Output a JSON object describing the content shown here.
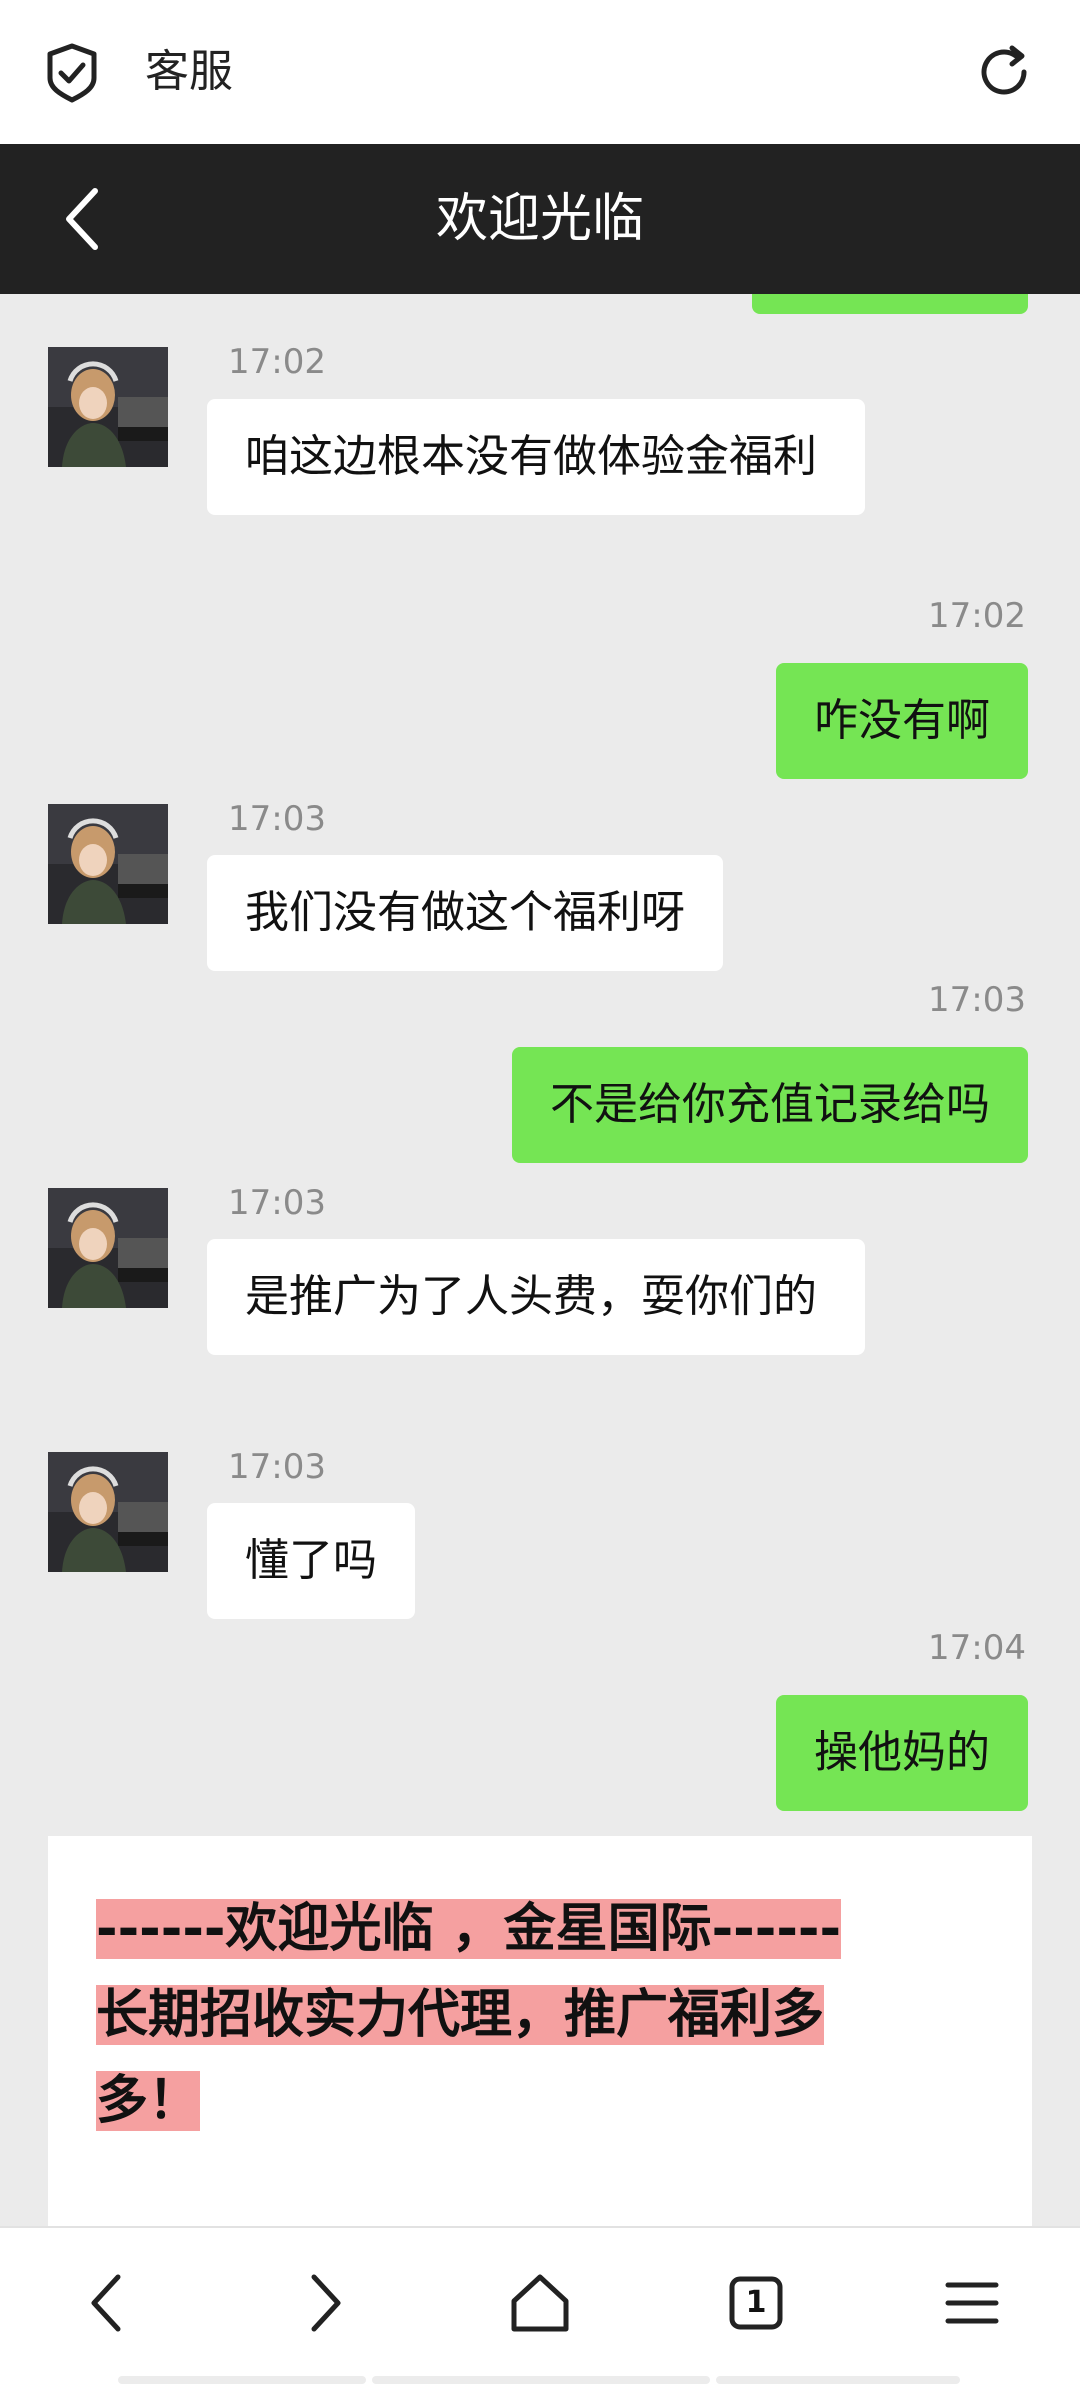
{
  "topbar": {
    "title": "客服",
    "left_icon": "shield-check-icon",
    "right_icon": "refresh-icon"
  },
  "header": {
    "title": "欢迎光临",
    "back_icon": "back-arrow-icon"
  },
  "messages": [
    {
      "side": "in",
      "time": "17:02",
      "text": "咱这边根本没有做体验金福利"
    },
    {
      "side": "out",
      "time": "17:02",
      "text": "咋没有啊"
    },
    {
      "side": "in",
      "time": "17:03",
      "text": "我们没有做这个福利呀"
    },
    {
      "side": "out",
      "time": "17:03",
      "text": "不是给你充值记录给吗"
    },
    {
      "side": "in",
      "time": "17:03",
      "text": "是推广为了人头费，耍你们的"
    },
    {
      "side": "in",
      "time": "17:03",
      "text": "懂了吗"
    },
    {
      "side": "out",
      "time": "17:04",
      "text": "操他妈的"
    }
  ],
  "announcement": {
    "line1": "------欢迎光临 ，金星国际------",
    "line2": "长期招收实力代理，推广福利多多！"
  },
  "bottom_nav": {
    "tab_count": "1",
    "icons": [
      "back-icon",
      "forward-icon",
      "home-icon",
      "tabs-icon",
      "menu-icon"
    ]
  },
  "colors": {
    "header_bg": "#222222",
    "out_bubble": "#75e554",
    "in_bubble": "#ffffff",
    "chat_bg": "#ebebeb",
    "highlight": "#f5a0a0"
  }
}
